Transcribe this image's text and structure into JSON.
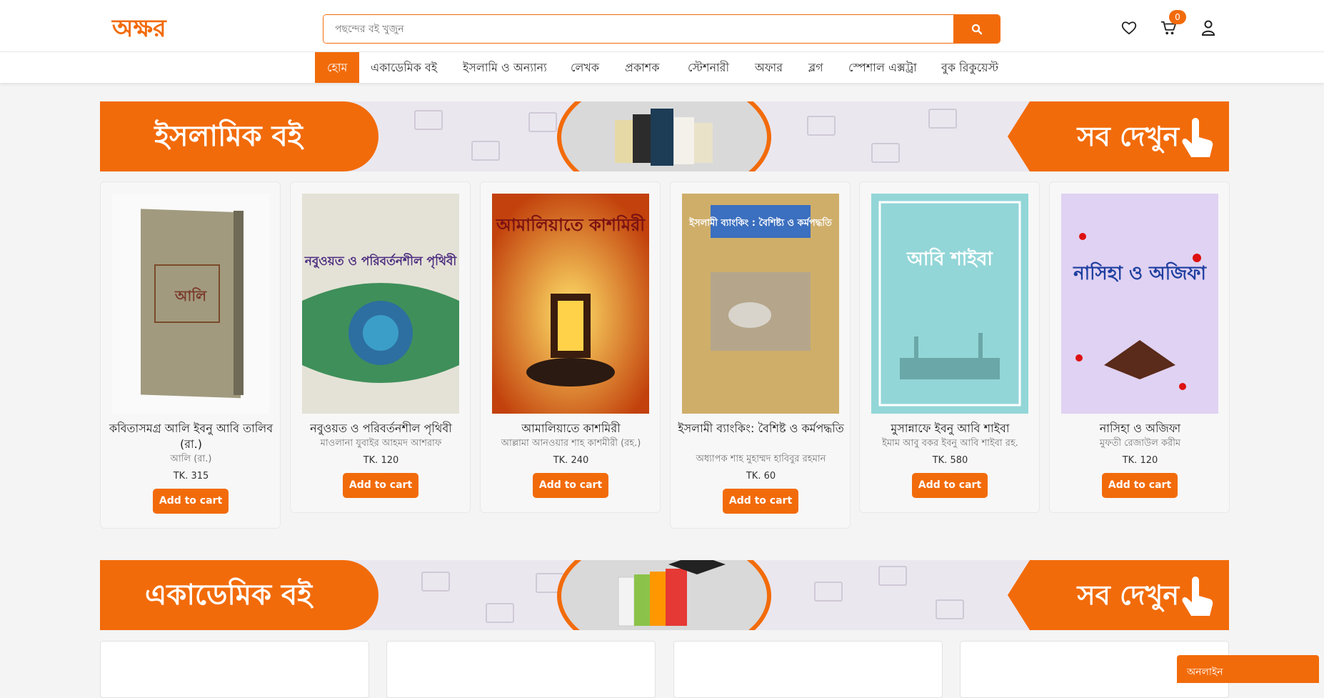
{
  "header": {
    "logo_text": "অক্ষর",
    "search_placeholder": "পছন্দের বই খুজুন",
    "cart_count": "0"
  },
  "nav": {
    "items": [
      "হোম",
      "একাডেমিক বই",
      "ইসলামি ও অন্যান্য",
      "লেখক",
      "প্রকাশক",
      "স্টেশনারী",
      "অফার",
      "ব্লগ",
      "স্পেশাল এক্সট্রা",
      "বুক রিকুয়েস্ট"
    ]
  },
  "sections": [
    {
      "title": "ইসলামিক বই",
      "see_all": "সব দেখুন"
    },
    {
      "title": "একাডেমিক বই",
      "see_all": "সব দেখুন"
    }
  ],
  "products": [
    {
      "title": "কবিতাসমগ্র আলি ইবনু আবি তালিব (রা.)",
      "author": "আলি (রা.)",
      "price": "TK. 315",
      "cart": "Add to cart",
      "cover_color": "#a19a7e"
    },
    {
      "title": "নবুওয়ত ও পরিবর্তনশীল পৃথিবী",
      "author": "মাওলানা যুবাইর আহমদ আশরাফ",
      "price": "TK. 120",
      "cart": "Add to cart",
      "cover_color": "#3f8f5a"
    },
    {
      "title": "আমালিয়াতে কাশমিরী",
      "author": "আল্লামা আনওয়ার শাহ কাশমীরী (রহ.)",
      "price": "TK. 240",
      "cart": "Add to cart",
      "cover_color": "#e8891a"
    },
    {
      "title": "ইসলামী ব্যাংকিং: বৈশিষ্ট ও কর্মপদ্ধতি",
      "author": "অধ্যাপক শাহ মুহাম্মদ হাবিবুর রহমান",
      "price": "TK. 60",
      "cart": "Add to cart",
      "cover_color": "#c9a96b"
    },
    {
      "title": "মুসান্নাফে ইবনু আবি শাইবা",
      "author": "ইমাম আবু বকর ইবনু আবি শাইবা রহ.",
      "price": "TK. 580",
      "cart": "Add to cart",
      "cover_color": "#8fd3d6"
    },
    {
      "title": "নাসিহা ও অজিফা",
      "author": "মুফতী রেজাউল করীম",
      "price": "TK. 120",
      "cart": "Add to cart",
      "cover_color": "#d8c9ee"
    }
  ],
  "cover_texts": [
    "আলি",
    "নবুওয়ত ও পরিবর্তনশীল পৃথিবী",
    "আমালিয়াতে কাশমিরী",
    "ইসলামী ব্যাংকিং : বৈশিষ্ট্য ও কর্মপদ্ধতি",
    "আবি শাইবা",
    "নাসিহা ও অজিফা"
  ],
  "chat": {
    "label": "অনলাইন"
  },
  "colors": {
    "accent": "#f26b0a"
  }
}
